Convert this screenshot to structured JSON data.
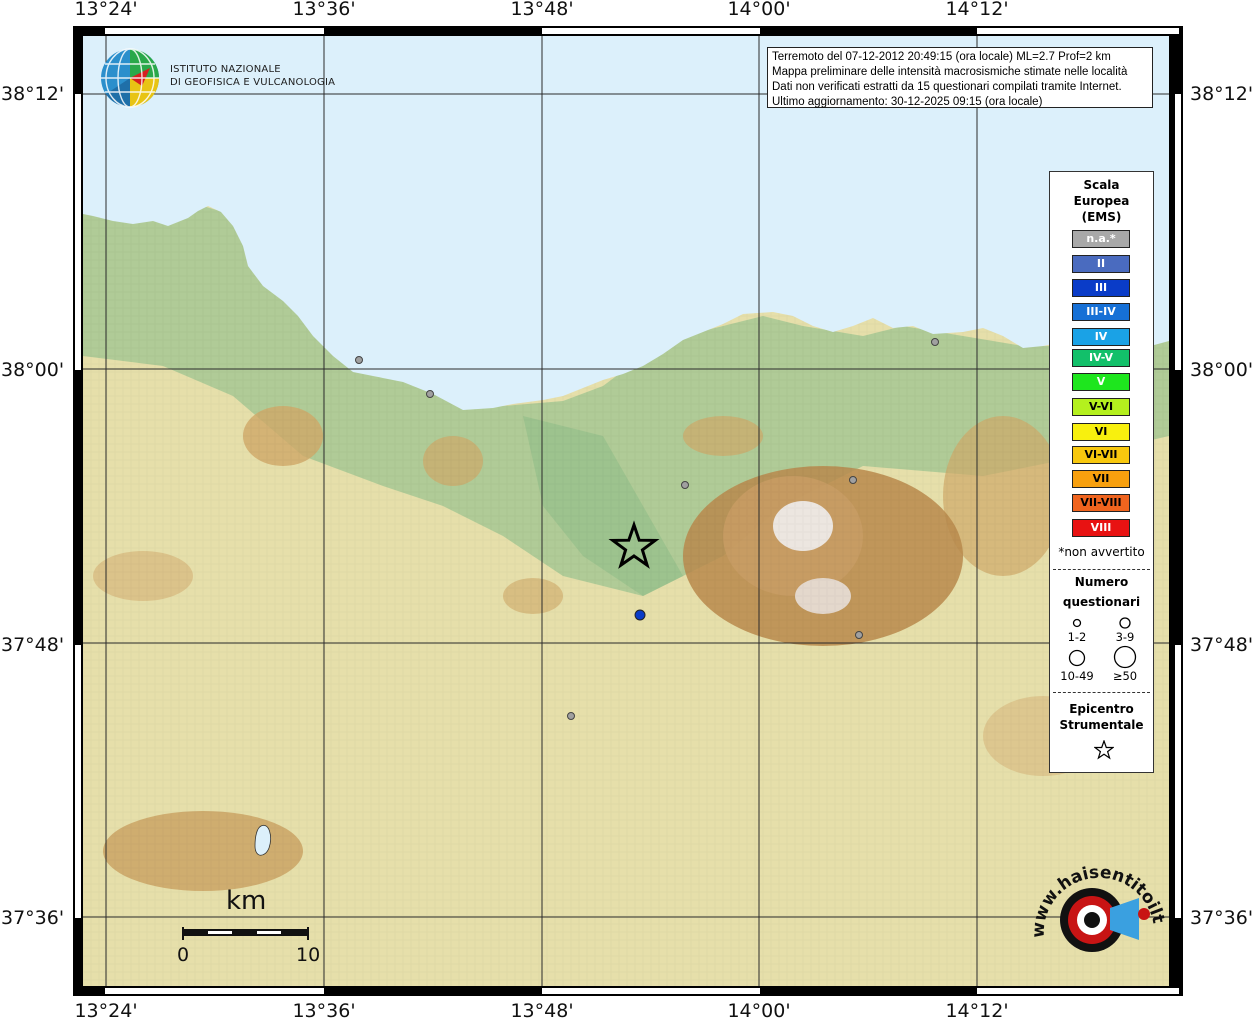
{
  "ticks": {
    "top": [
      "13°24'",
      "13°36'",
      "13°48'",
      "14°00'",
      "14°12'"
    ],
    "bottom": [
      "13°24'",
      "13°36'",
      "13°48'",
      "14°00'",
      "14°12'"
    ],
    "left": [
      "38°12'",
      "38°00'",
      "37°48'",
      "37°36'"
    ],
    "right": [
      "38°12'",
      "38°00'",
      "37°48'",
      "37°36'"
    ]
  },
  "institute": {
    "line1": "ISTITUTO NAZIONALE",
    "line2": "DI GEOFISICA E VULCANOLOGIA"
  },
  "info": {
    "line1": "Terremoto del 07-12-2012 20:49:15 (ora locale) ML=2.7 Prof=2 km",
    "line2": "Mappa preliminare delle intensità macrosismiche stimate nelle località",
    "line3": "Dati non verificati estratti da 15 questionari compilati tramite Internet.",
    "line4": "Ultimo aggiornamento: 30-12-2025 09:15 (ora locale)"
  },
  "legend": {
    "title1": "Scala",
    "title2": "Europea",
    "title3": "(EMS)",
    "levels": [
      {
        "label": "n.a.*",
        "color": "#a8a8a8"
      },
      {
        "label": "II",
        "color": "#4a6bbf"
      },
      {
        "label": "III",
        "color": "#0a3cc8"
      },
      {
        "label": "III-IV",
        "color": "#1670d6"
      },
      {
        "label": "IV",
        "color": "#1aa2e6"
      },
      {
        "label": "IV-V",
        "color": "#12c06a"
      },
      {
        "label": "V",
        "color": "#1ee61e"
      },
      {
        "label": "V-VI",
        "color": "#b4f01e"
      },
      {
        "label": "VI",
        "color": "#f8f00e"
      },
      {
        "label": "VI-VII",
        "color": "#f8c80e"
      },
      {
        "label": "VII",
        "color": "#f8a00e"
      },
      {
        "label": "VII-VIII",
        "color": "#f0641e"
      },
      {
        "label": "VIII",
        "color": "#e81212"
      }
    ],
    "not_felt_note": "*non avvertito",
    "count_title1": "Numero",
    "count_title2": "questionari",
    "count_sizes": [
      "1-2",
      "3-9",
      "10-49",
      "≥50"
    ],
    "epicenter_title1": "Epicentro",
    "epicenter_title2": "Strumentale"
  },
  "scale_bar": {
    "unit": "km",
    "start": "0",
    "end": "10"
  },
  "logo_text": "www.haisentitoilterremoto.it",
  "colors": {
    "sea": "#dcf0fb",
    "lowland_green": "#9cc496",
    "plain": "#e8e3b0",
    "hill": "#c8a86a",
    "mountain": "#b08246",
    "peak": "#ece6e0",
    "epicenter_star": "#000000",
    "felt_point_III": "#0a3cc8",
    "not_felt_point": "#a0a0a0"
  }
}
